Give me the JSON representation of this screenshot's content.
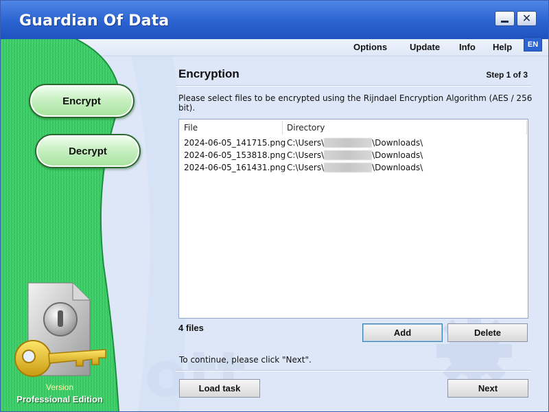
{
  "window": {
    "title": "Guardian Of Data"
  },
  "menu": {
    "options": "Options",
    "update": "Update",
    "info": "Info",
    "help": "Help",
    "language": "EN"
  },
  "sidebar": {
    "encrypt_label": "Encrypt",
    "decrypt_label": "Decrypt",
    "version_label": "Version",
    "edition_label": "Professional Edition"
  },
  "main": {
    "title": "Encryption",
    "step": "Step 1 of 3",
    "instruction": "Please select files to be encrypted using the Rijndael Encryption Algorithm (AES / 256 bit).",
    "columns": {
      "file": "File",
      "directory": "Directory"
    },
    "rows": [
      {
        "file": "2024-06-05_141715.png",
        "dir_prefix": "C:\\Users\\",
        "dir_suffix": "\\Downloads\\"
      },
      {
        "file": "2024-06-05_153818.png",
        "dir_prefix": "C:\\Users\\",
        "dir_suffix": "\\Downloads\\"
      },
      {
        "file": "2024-06-05_161431.png",
        "dir_prefix": "C:\\Users\\",
        "dir_suffix": "\\Downloads\\"
      }
    ],
    "file_count": "4 files",
    "add_label": "Add",
    "delete_label": "Delete",
    "continue_text": "To continue, please click \"Next\".",
    "load_task_label": "Load task",
    "next_label": "Next"
  },
  "colors": {
    "title_bar": "#2b63d0",
    "sidebar_green": "#3fcf66",
    "content_bg": "#dde7f7",
    "language_button": "#2b63d0"
  }
}
